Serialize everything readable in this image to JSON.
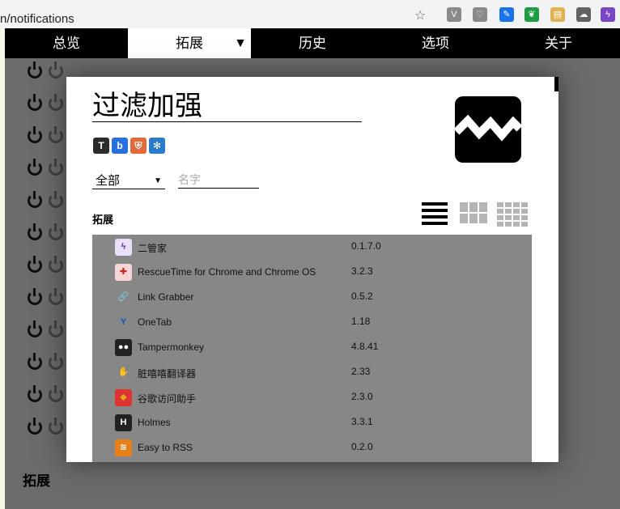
{
  "browser": {
    "url_text": "n/notifications",
    "star_icon": "star-outline-icon",
    "extension_icons": [
      {
        "name": "vue-devtools-icon",
        "color": "#8a8a8a",
        "glyph": "V"
      },
      {
        "name": "pocket-icon",
        "color": "#8a8a8a",
        "glyph": "♡"
      },
      {
        "name": "edit-icon",
        "color": "#1a73e8",
        "glyph": "✎"
      },
      {
        "name": "evernote-icon",
        "color": "#1c9c45",
        "glyph": "❦"
      },
      {
        "name": "notes-icon",
        "color": "#e0b252",
        "glyph": "▤"
      },
      {
        "name": "cloud-icon",
        "color": "#5f6368",
        "glyph": "☁"
      },
      {
        "name": "extension-manager-icon",
        "color": "#7b46c5",
        "glyph": "ϟ"
      }
    ]
  },
  "nav": {
    "items": [
      "总览",
      "拓展",
      "历史",
      "选项",
      "关于"
    ],
    "active_index": 1,
    "caret": "▼"
  },
  "background_page": {
    "row_count": 12,
    "section_heading": "拓展"
  },
  "modal": {
    "title": "过滤加强",
    "filter": {
      "selected": "全部",
      "arrow": "▼"
    },
    "name_placeholder": "名字",
    "section_label": "拓展",
    "permission_icons": [
      {
        "name": "tampermonkey-icon",
        "glyph": "T",
        "bg": "#2b2b2b"
      },
      {
        "name": "baidu-icon",
        "glyph": "b",
        "bg": "#2a6fe0"
      },
      {
        "name": "shield-icon",
        "glyph": "⛨",
        "bg": "#e06a3a"
      },
      {
        "name": "snowflake-icon",
        "glyph": "✻",
        "bg": "#2a7cc8"
      }
    ],
    "extensions": [
      {
        "name": "二管家",
        "version": "0.1.7.0",
        "icon": "extension-manager-icon",
        "glyph": "ϟ",
        "fg": "#6a2bb8",
        "bg": "#e9dff8"
      },
      {
        "name": "RescueTime for Chrome and Chrome OS",
        "version": "3.2.3",
        "icon": "rescuetime-icon",
        "glyph": "✚",
        "fg": "#c22",
        "bg": "#f5d5d5"
      },
      {
        "name": "Link Grabber",
        "version": "0.5.2",
        "icon": "link-icon",
        "glyph": "🔗",
        "fg": "#555",
        "bg": "transparent"
      },
      {
        "name": "OneTab",
        "version": "1.18",
        "icon": "onetab-icon",
        "glyph": "Y",
        "fg": "#0a58c9",
        "bg": "transparent"
      },
      {
        "name": "Tampermonkey",
        "version": "4.8.41",
        "icon": "tampermonkey-icon",
        "glyph": "●●",
        "fg": "#fff",
        "bg": "#222"
      },
      {
        "name": "脏嘻嘻翻译器",
        "version": "2.33",
        "icon": "hand-icon",
        "glyph": "✋",
        "fg": "#222",
        "bg": "transparent"
      },
      {
        "name": "谷歌访问助手",
        "version": "2.3.0",
        "icon": "google-helper-icon",
        "glyph": "◆",
        "fg": "#e8a21a",
        "bg": "#d33"
      },
      {
        "name": "Holmes",
        "version": "3.3.1",
        "icon": "holmes-icon",
        "glyph": "H",
        "fg": "#fff",
        "bg": "#222"
      },
      {
        "name": "Easy to RSS",
        "version": "0.2.0",
        "icon": "rss-icon",
        "glyph": "≋",
        "fg": "#fff",
        "bg": "#e8801a"
      }
    ]
  }
}
